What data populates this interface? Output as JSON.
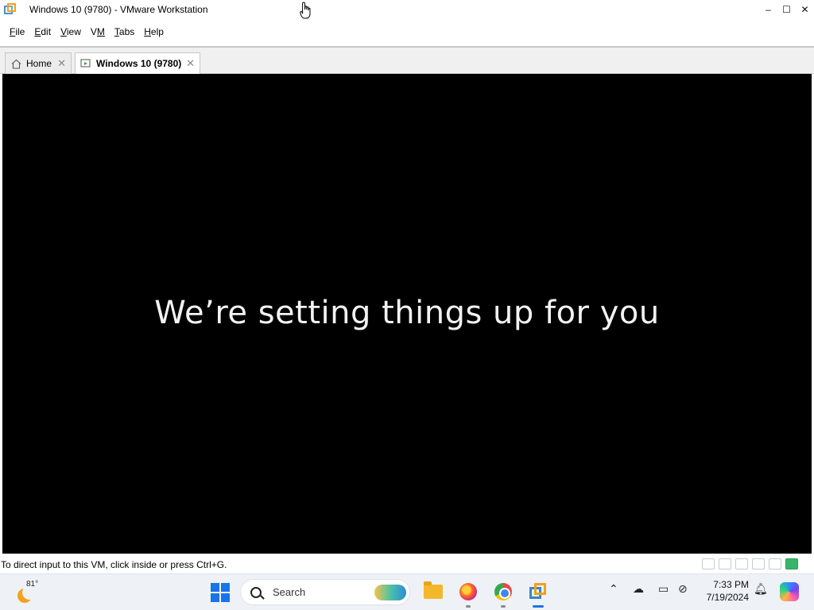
{
  "window": {
    "title": "Windows 10 (9780) - VMware Workstation",
    "controls": {
      "minimize": "–",
      "maximize": "☐",
      "close": "✕"
    }
  },
  "menubar": {
    "items": [
      {
        "label": "File",
        "accel": "F"
      },
      {
        "label": "Edit",
        "accel": "E"
      },
      {
        "label": "View",
        "accel": "V"
      },
      {
        "label": "VM",
        "accel": "M"
      },
      {
        "label": "Tabs",
        "accel": "T"
      },
      {
        "label": "Help",
        "accel": "H"
      }
    ]
  },
  "tabs": [
    {
      "label": "Home",
      "icon": "home-icon",
      "close": "✕"
    },
    {
      "label": "Windows 10 (9780)",
      "icon": "vm-icon",
      "close": "✕",
      "active": true
    }
  ],
  "vm_screen": {
    "message": "We’re setting things up for you",
    "background": "#000000"
  },
  "statusbar": {
    "hint": "To direct input to this VM, click inside or press Ctrl+G."
  },
  "taskbar": {
    "weather": {
      "temperature": "81°"
    },
    "search": {
      "placeholder": "Search"
    },
    "clock": {
      "time": "7:33 PM",
      "date": "7/19/2024"
    }
  },
  "colors": {
    "start_accent": "#1a73e8",
    "vm_background": "#000000",
    "status_green": "#39b56a"
  }
}
